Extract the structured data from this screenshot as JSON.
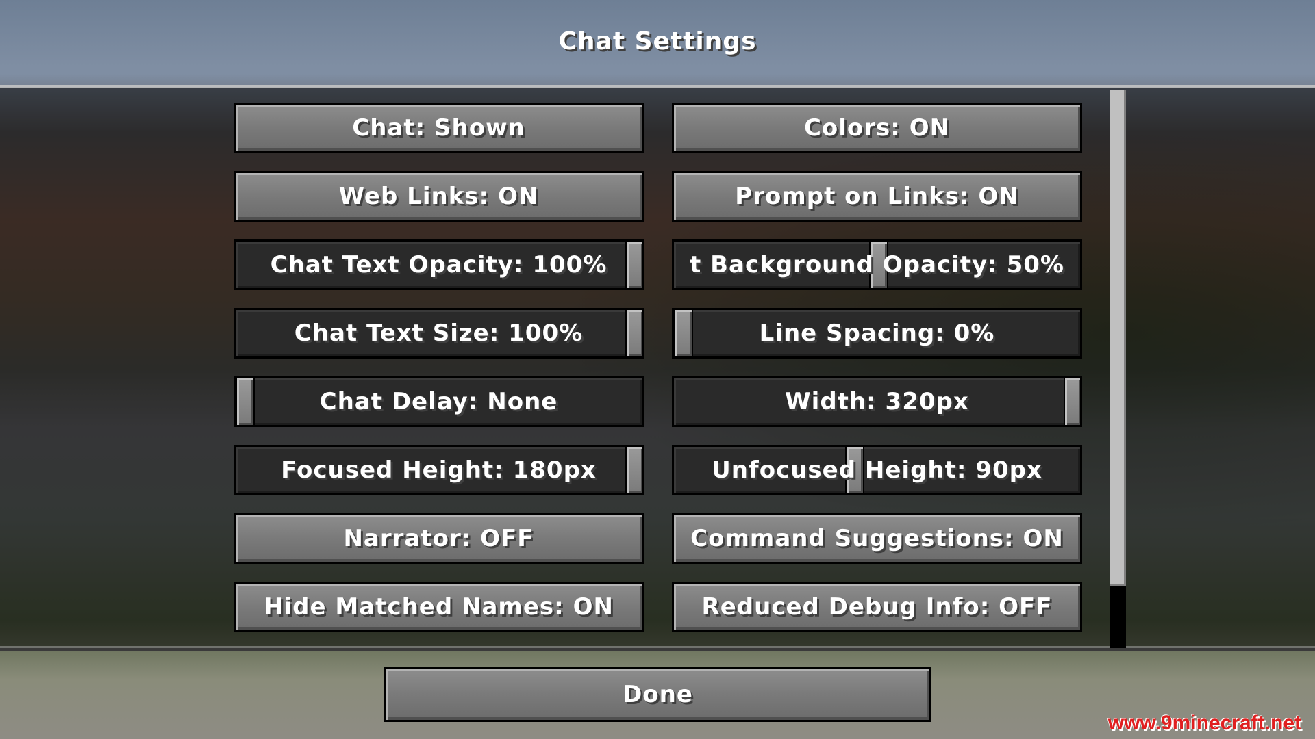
{
  "screen": {
    "title": "Chat Settings"
  },
  "options": [
    {
      "label": "Chat: Shown",
      "kind": "toggle"
    },
    {
      "label": "Colors: ON",
      "kind": "toggle"
    },
    {
      "label": "Web Links: ON",
      "kind": "toggle"
    },
    {
      "label": "Prompt on Links: ON",
      "kind": "toggle"
    },
    {
      "label": "Chat Text Opacity: 100%",
      "kind": "slider",
      "level": 1.0
    },
    {
      "label": "t Background Opacity: 50%",
      "kind": "slider",
      "level": 0.5
    },
    {
      "label": "Chat Text Size: 100%",
      "kind": "slider",
      "level": 1.0
    },
    {
      "label": "Line Spacing: 0%",
      "kind": "slider",
      "level": 0.0
    },
    {
      "label": "Chat Delay: None",
      "kind": "slider",
      "level": 0.0
    },
    {
      "label": "Width: 320px",
      "kind": "slider",
      "level": 1.0
    },
    {
      "label": "Focused Height: 180px",
      "kind": "slider",
      "level": 1.0
    },
    {
      "label": "Unfocused Height: 90px",
      "kind": "slider",
      "level": 0.44
    },
    {
      "label": "Narrator: OFF",
      "kind": "toggle"
    },
    {
      "label": "Command Suggestions: ON",
      "kind": "toggle"
    },
    {
      "label": "Hide Matched Names: ON",
      "kind": "toggle"
    },
    {
      "label": "Reduced Debug Info: OFF",
      "kind": "toggle"
    }
  ],
  "done_label": "Done",
  "watermark": "www.9minecraft.net",
  "scrollbar": {
    "position": 0.0
  }
}
